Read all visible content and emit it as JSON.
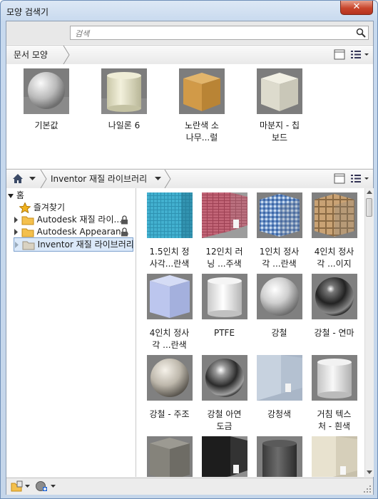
{
  "window": {
    "title": "모양 검색기",
    "close_label": "✕"
  },
  "search": {
    "placeholder": "검색"
  },
  "doc_bar": {
    "crumb": "문서 모양"
  },
  "doc_items": [
    {
      "label": "기본값",
      "material": "sphere-gray"
    },
    {
      "label": "나일론 6",
      "material": "cylinder-cream"
    },
    {
      "label": "노란색 소\n나무...럴",
      "material": "cube-pine"
    },
    {
      "label": "마분지 - 칩\n보드",
      "material": "cube-board"
    }
  ],
  "lib_bar": {
    "crumb": "Inventor 재질 라이브러리"
  },
  "tree": {
    "root": "홈",
    "items": [
      {
        "label": "즐겨찾기",
        "icon": "star-icon",
        "locked": false,
        "expandable": false
      },
      {
        "label": "Autodesk 재질 라이...",
        "icon": "folder-icon",
        "locked": true,
        "expandable": true
      },
      {
        "label": "Autodesk Appearan...",
        "icon": "folder-icon",
        "locked": true,
        "expandable": true
      },
      {
        "label": "Inventor 재질 라이브러리",
        "icon": "folder-icon",
        "locked": false,
        "expandable": true,
        "selected": true
      }
    ]
  },
  "library_items": [
    {
      "label": "1.5인치 정\n사각...란색",
      "material": "tile-blue"
    },
    {
      "label": "12인치 러\n닝 ...주색",
      "material": "tile-red"
    },
    {
      "label": "1인치 정사\n각 ...란색",
      "material": "tile-mixblue"
    },
    {
      "label": "4인치 정사\n각 ...이지",
      "material": "tile-beige"
    },
    {
      "label": "4인치 정사\n각 ...란색",
      "material": "cube-lavender"
    },
    {
      "label": "PTFE",
      "material": "cylinder-white"
    },
    {
      "label": "강철",
      "material": "sphere-steel"
    },
    {
      "label": "강철 - 연마",
      "material": "sphere-chrome"
    },
    {
      "label": "강철 - 주조",
      "material": "sphere-cast"
    },
    {
      "label": "강철 아연\n도금",
      "material": "sphere-galv"
    },
    {
      "label": "강청색",
      "material": "corner-bluegray"
    },
    {
      "label": "거침 텍스\n처 - 흰색",
      "material": "cylinder-rough"
    },
    {
      "label": "",
      "material": "cube-concrete"
    },
    {
      "label": "",
      "material": "cube-black"
    },
    {
      "label": "",
      "material": "cylinder-dark"
    },
    {
      "label": "",
      "material": "corner-cream"
    }
  ],
  "colors": {
    "accent": "#7da2ce",
    "close": "#c8452b",
    "frame": "#c5d6ea"
  }
}
